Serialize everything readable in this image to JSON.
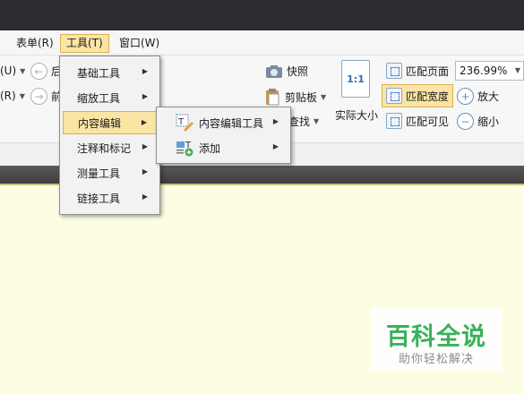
{
  "menubar": {
    "items": [
      {
        "label": "表单(R)"
      },
      {
        "label": "工具(T)"
      },
      {
        "label": "窗口(W)"
      }
    ]
  },
  "ribbon": {
    "partial_left_top": "(U)",
    "partial_left_bottom": "(R)",
    "partial_nav_top": "后",
    "partial_nav_bottom": "前",
    "snapshot": "快照",
    "clipboard": "剪贴板",
    "find": "查找",
    "actual_size": "实际大小",
    "actual_size_icon_text": "1:1",
    "fit_page": "匹配页面",
    "fit_width": "匹配宽度",
    "fit_visible": "匹配可见",
    "zoom_value": "236.99%",
    "zoom_in": "放大",
    "zoom_out": "缩小"
  },
  "tools_menu": {
    "items": [
      {
        "label": "基础工具",
        "has_submenu": true
      },
      {
        "label": "缩放工具",
        "has_submenu": true
      },
      {
        "label": "内容编辑",
        "has_submenu": true,
        "selected": true
      },
      {
        "label": "注释和标记",
        "has_submenu": true
      },
      {
        "label": "测量工具",
        "has_submenu": true
      },
      {
        "label": "链接工具",
        "has_submenu": true
      }
    ]
  },
  "content_edit_submenu": {
    "items": [
      {
        "label": "内容编辑工具",
        "icon": "text-edit-icon",
        "has_submenu": true
      },
      {
        "label": "添加",
        "icon": "add-content-icon",
        "has_submenu": true
      }
    ]
  },
  "watermark": {
    "title": "百科全说",
    "subtitle": "助你轻松解决"
  },
  "colors": {
    "titlebar": "#2b2d33",
    "menu_highlight": "#fbe5a4",
    "menu_highlight_border": "#d9b04c",
    "canvas": "#fdfde4",
    "watermark_green": "#2fae52"
  }
}
